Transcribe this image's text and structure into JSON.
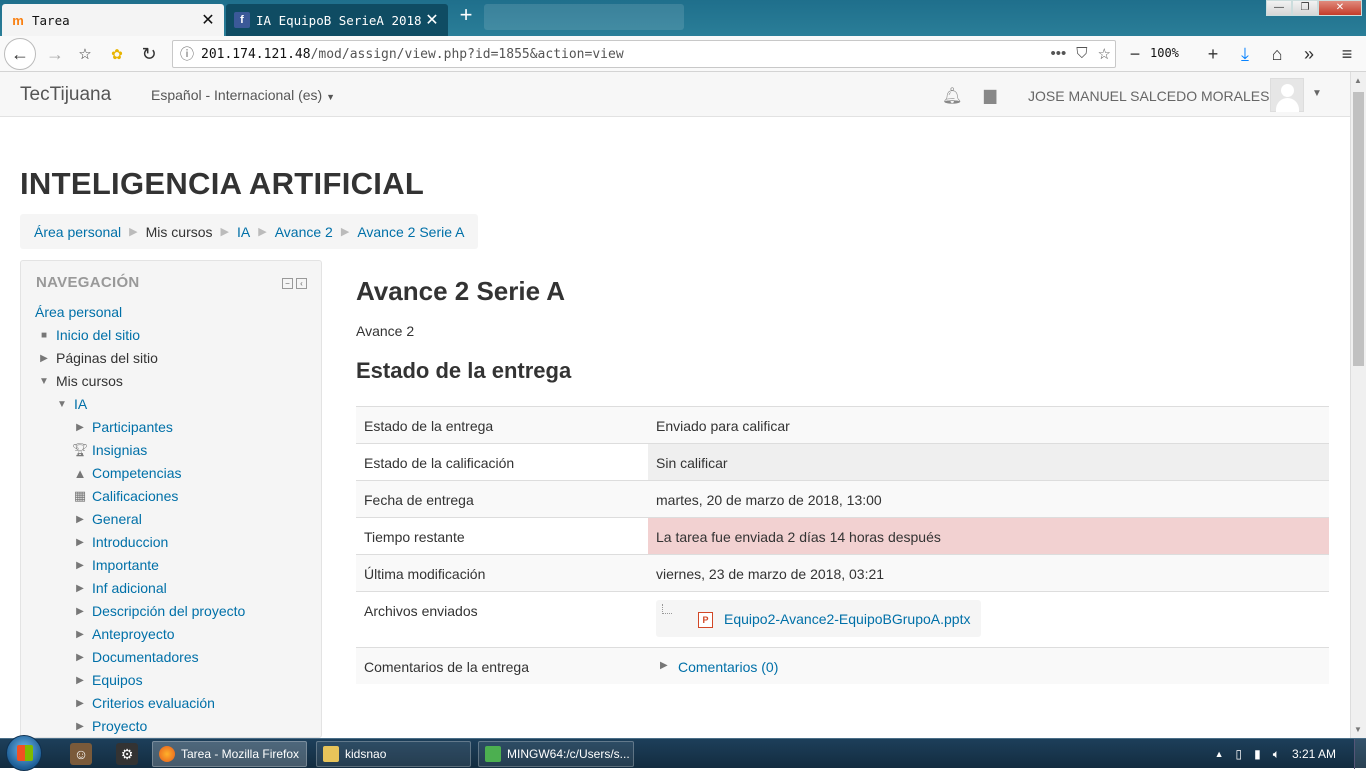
{
  "browser": {
    "tabs": [
      {
        "favicon": "moodle-icon",
        "title": "Tarea"
      },
      {
        "favicon": "facebook-icon",
        "title": "IA EquipoB SerieA 2018"
      }
    ],
    "url_host": "201.174.121.48",
    "url_path": "/mod/assign/view.php?id=1855&action=view",
    "zoom": "100%"
  },
  "header": {
    "brand": "TecTijuana",
    "language": "Español - Internacional (es)",
    "user_name": "JOSE MANUEL SALCEDO MORALES"
  },
  "course_title": "INTELIGENCIA ARTIFICIAL",
  "breadcrumb": [
    "Área personal",
    "Mis cursos",
    "IA",
    "Avance 2",
    "Avance 2 Serie A"
  ],
  "navigation": {
    "title": "NAVEGACIÓN",
    "items": [
      {
        "label": "Área personal",
        "icon": "none",
        "link": true
      },
      {
        "label": "Inicio del sitio",
        "icon": "bullet-icon",
        "link": true
      },
      {
        "label": "Páginas del sitio",
        "icon": "expand-icon",
        "link": false
      },
      {
        "label": "Mis cursos",
        "icon": "collapse-icon",
        "link": false
      },
      {
        "label": "IA",
        "icon": "collapse-icon",
        "link": true
      },
      {
        "label": "Participantes",
        "icon": "expand-icon",
        "link": true
      },
      {
        "label": "Insignias",
        "icon": "trophy-icon",
        "link": true
      },
      {
        "label": "Competencias",
        "icon": "competency-icon",
        "link": true
      },
      {
        "label": "Calificaciones",
        "icon": "grades-table-icon",
        "link": true
      },
      {
        "label": "General",
        "icon": "expand-icon",
        "link": true
      },
      {
        "label": "Introduccion",
        "icon": "expand-icon",
        "link": true
      },
      {
        "label": "Importante",
        "icon": "expand-icon",
        "link": true
      },
      {
        "label": "Inf adicional",
        "icon": "expand-icon",
        "link": true
      },
      {
        "label": "Descripción del proyecto",
        "icon": "expand-icon",
        "link": true
      },
      {
        "label": "Anteproyecto",
        "icon": "expand-icon",
        "link": true
      },
      {
        "label": "Documentadores",
        "icon": "expand-icon",
        "link": true
      },
      {
        "label": "Equipos",
        "icon": "expand-icon",
        "link": true
      },
      {
        "label": "Criterios evaluación",
        "icon": "expand-icon",
        "link": true
      },
      {
        "label": "Proyecto",
        "icon": "expand-icon",
        "link": true
      }
    ]
  },
  "assignment": {
    "title": "Avance 2 Serie A",
    "intro": "Avance 2",
    "status_heading": "Estado de la entrega",
    "rows": [
      {
        "label": "Estado de la entrega",
        "value": "Enviado para calificar"
      },
      {
        "label": "Estado de la calificación",
        "value": "Sin calificar"
      },
      {
        "label": "Fecha de entrega",
        "value": "martes, 20 de marzo de 2018, 13:00"
      },
      {
        "label": "Tiempo restante",
        "value": "La tarea fue enviada 2 días 14 horas después"
      },
      {
        "label": "Última modificación",
        "value": "viernes, 23 de marzo de 2018, 03:21"
      },
      {
        "label": "Archivos enviados",
        "value": "Equipo2-Avance2-EquipoBGrupoA.pptx"
      },
      {
        "label": "Comentarios de la entrega",
        "value": "Comentarios (0)"
      }
    ],
    "status_colors": {
      "late": "#f2d1d1",
      "grading": "#efefef"
    }
  },
  "taskbar": {
    "tasks": [
      "Tarea - Mozilla Firefox",
      "kidsnao",
      "MINGW64:/c/Users/s..."
    ],
    "clock": "3:21 AM"
  }
}
